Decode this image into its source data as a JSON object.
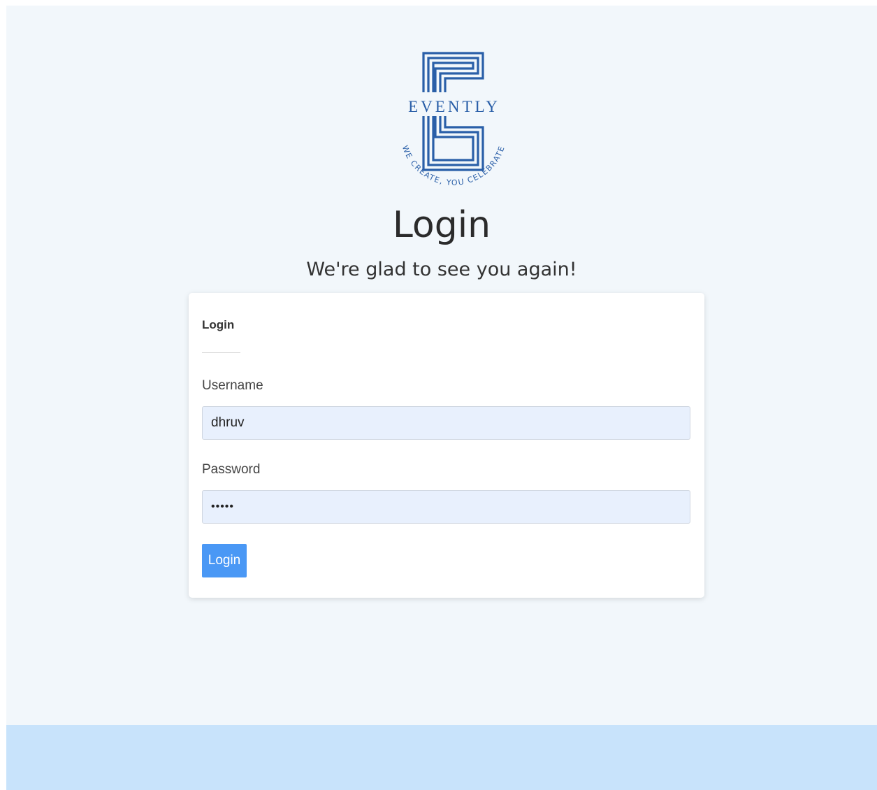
{
  "brand": {
    "name": "EVENTLY",
    "tagline": "WE CREATE, YOU CELEBRATE",
    "color": "#2a5fa8"
  },
  "header": {
    "title": "Login",
    "subtitle": "We're glad to see you again!"
  },
  "form": {
    "card_title": "Login",
    "username": {
      "label": "Username",
      "value": "dhruv"
    },
    "password": {
      "label": "Password",
      "value": "•••••"
    },
    "submit_label": "Login",
    "button_color": "#4a98f5"
  }
}
